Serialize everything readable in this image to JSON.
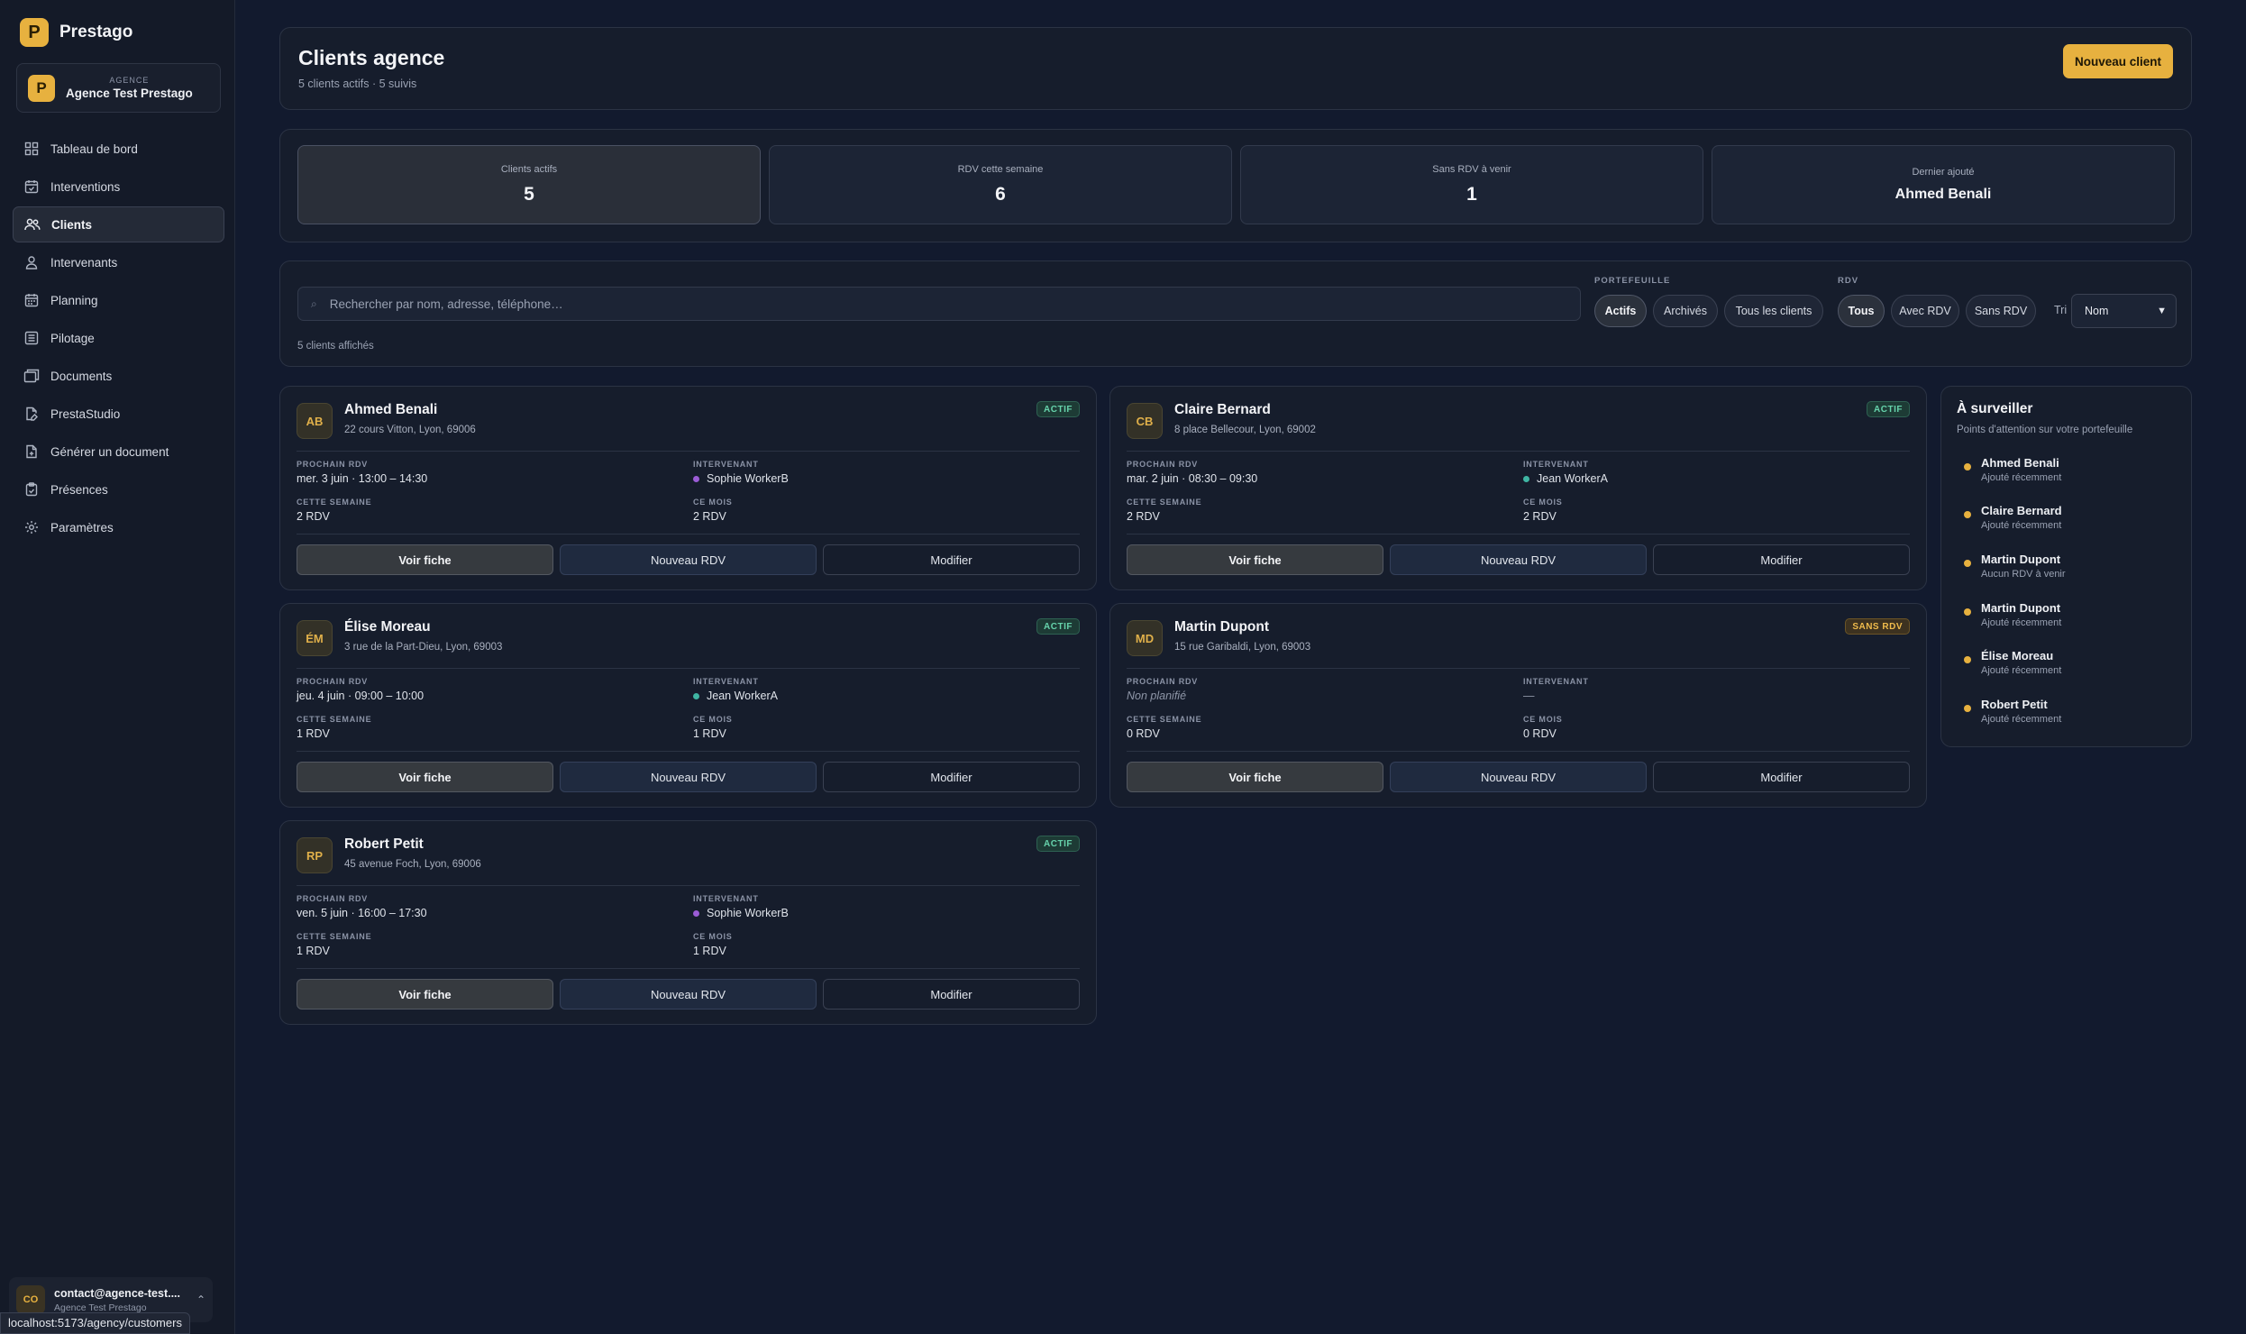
{
  "app": {
    "name": "Prestago",
    "logo_letter": "P"
  },
  "agency": {
    "tag": "AGENCE",
    "name": "Agence Test Prestago",
    "icon_letter": "P"
  },
  "nav": [
    {
      "label": "Tableau de bord",
      "icon": "dashboard-icon"
    },
    {
      "label": "Interventions",
      "icon": "calendar-check-icon"
    },
    {
      "label": "Clients",
      "icon": "users-icon",
      "active": true
    },
    {
      "label": "Intervenants",
      "icon": "user-icon"
    },
    {
      "label": "Planning",
      "icon": "calendar-icon"
    },
    {
      "label": "Pilotage",
      "icon": "list-icon"
    },
    {
      "label": "Documents",
      "icon": "documents-icon"
    },
    {
      "label": "PrestaStudio",
      "icon": "file-edit-icon"
    },
    {
      "label": "Générer un document",
      "icon": "file-plus-icon"
    },
    {
      "label": "Présences",
      "icon": "clipboard-check-icon"
    },
    {
      "label": "Paramètres",
      "icon": "gear-icon"
    }
  ],
  "user": {
    "initials": "CO",
    "email": "contact@agence-test....",
    "agency": "Agence Test Prestago"
  },
  "status_bar": {
    "url": "localhost:5173/agency/customers"
  },
  "header": {
    "title": "Clients agence",
    "subtitle": "5 clients actifs · 5 suivis",
    "new_client_label": "Nouveau client"
  },
  "stats": [
    {
      "label": "Clients actifs",
      "value": "5"
    },
    {
      "label": "RDV cette semaine",
      "value": "6"
    },
    {
      "label": "Sans RDV à venir",
      "value": "1"
    },
    {
      "label": "Dernier ajouté",
      "value": "Ahmed Benali"
    }
  ],
  "filters": {
    "search_placeholder": "Rechercher par nom, adresse, téléphone…",
    "portfolio_label": "PORTEFEUILLE",
    "portfolio_options": [
      "Actifs",
      "Archivés",
      "Tous les clients"
    ],
    "rdv_label": "RDV",
    "rdv_options": [
      "Tous",
      "Avec RDV",
      "Sans RDV"
    ],
    "sort_label": "Tri",
    "sort_value": "Nom",
    "results_count": "5 clients affichés"
  },
  "labels": {
    "next_rdv": "PROCHAIN RDV",
    "worker": "INTERVENANT",
    "this_week": "CETTE SEMAINE",
    "this_month": "CE MOIS",
    "view": "Voir fiche",
    "new_rdv": "Nouveau RDV",
    "edit": "Modifier"
  },
  "clients": [
    {
      "initials": "AB",
      "name": "Ahmed Benali",
      "address": "22 cours Vitton, Lyon, 69006",
      "badge": "ACTIF",
      "badge_type": "actif",
      "next_rdv": "mer. 3 juin · 13:00 – 14:30",
      "worker": "Sophie WorkerB",
      "worker_color": "#9b5cd6",
      "week": "2 RDV",
      "month": "2 RDV"
    },
    {
      "initials": "CB",
      "name": "Claire Bernard",
      "address": "8 place Bellecour, Lyon, 69002",
      "badge": "ACTIF",
      "badge_type": "actif",
      "next_rdv": "mar. 2 juin · 08:30 – 09:30",
      "worker": "Jean WorkerA",
      "worker_color": "#3fb5a3",
      "week": "2 RDV",
      "month": "2 RDV"
    },
    {
      "initials": "ÉM",
      "name": "Élise Moreau",
      "address": "3 rue de la Part-Dieu, Lyon, 69003",
      "badge": "ACTIF",
      "badge_type": "actif",
      "next_rdv": "jeu. 4 juin · 09:00 – 10:00",
      "worker": "Jean WorkerA",
      "worker_color": "#3fb5a3",
      "week": "1 RDV",
      "month": "1 RDV"
    },
    {
      "initials": "MD",
      "name": "Martin Dupont",
      "address": "15 rue Garibaldi, Lyon, 69003",
      "badge": "SANS RDV",
      "badge_type": "sans",
      "next_rdv": "Non planifié",
      "worker": "—",
      "worker_color": "",
      "week": "0 RDV",
      "month": "0 RDV"
    },
    {
      "initials": "RP",
      "name": "Robert Petit",
      "address": "45 avenue Foch, Lyon, 69006",
      "badge": "ACTIF",
      "badge_type": "actif",
      "next_rdv": "ven. 5 juin · 16:00 – 17:30",
      "worker": "Sophie WorkerB",
      "worker_color": "#9b5cd6",
      "week": "1 RDV",
      "month": "1 RDV"
    }
  ],
  "watch": {
    "title": "À surveiller",
    "subtitle": "Points d'attention sur votre portefeuille",
    "items": [
      {
        "name": "Ahmed Benali",
        "note": "Ajouté récemment"
      },
      {
        "name": "Claire Bernard",
        "note": "Ajouté récemment"
      },
      {
        "name": "Martin Dupont",
        "note": "Aucun RDV à venir"
      },
      {
        "name": "Martin Dupont",
        "note": "Ajouté récemment"
      },
      {
        "name": "Élise Moreau",
        "note": "Ajouté récemment"
      },
      {
        "name": "Robert Petit",
        "note": "Ajouté récemment"
      }
    ]
  },
  "colors": {
    "accent": "#e7b13f",
    "background": "#121a2e",
    "sidebar": "#141a28",
    "success": "#66d2ab"
  }
}
